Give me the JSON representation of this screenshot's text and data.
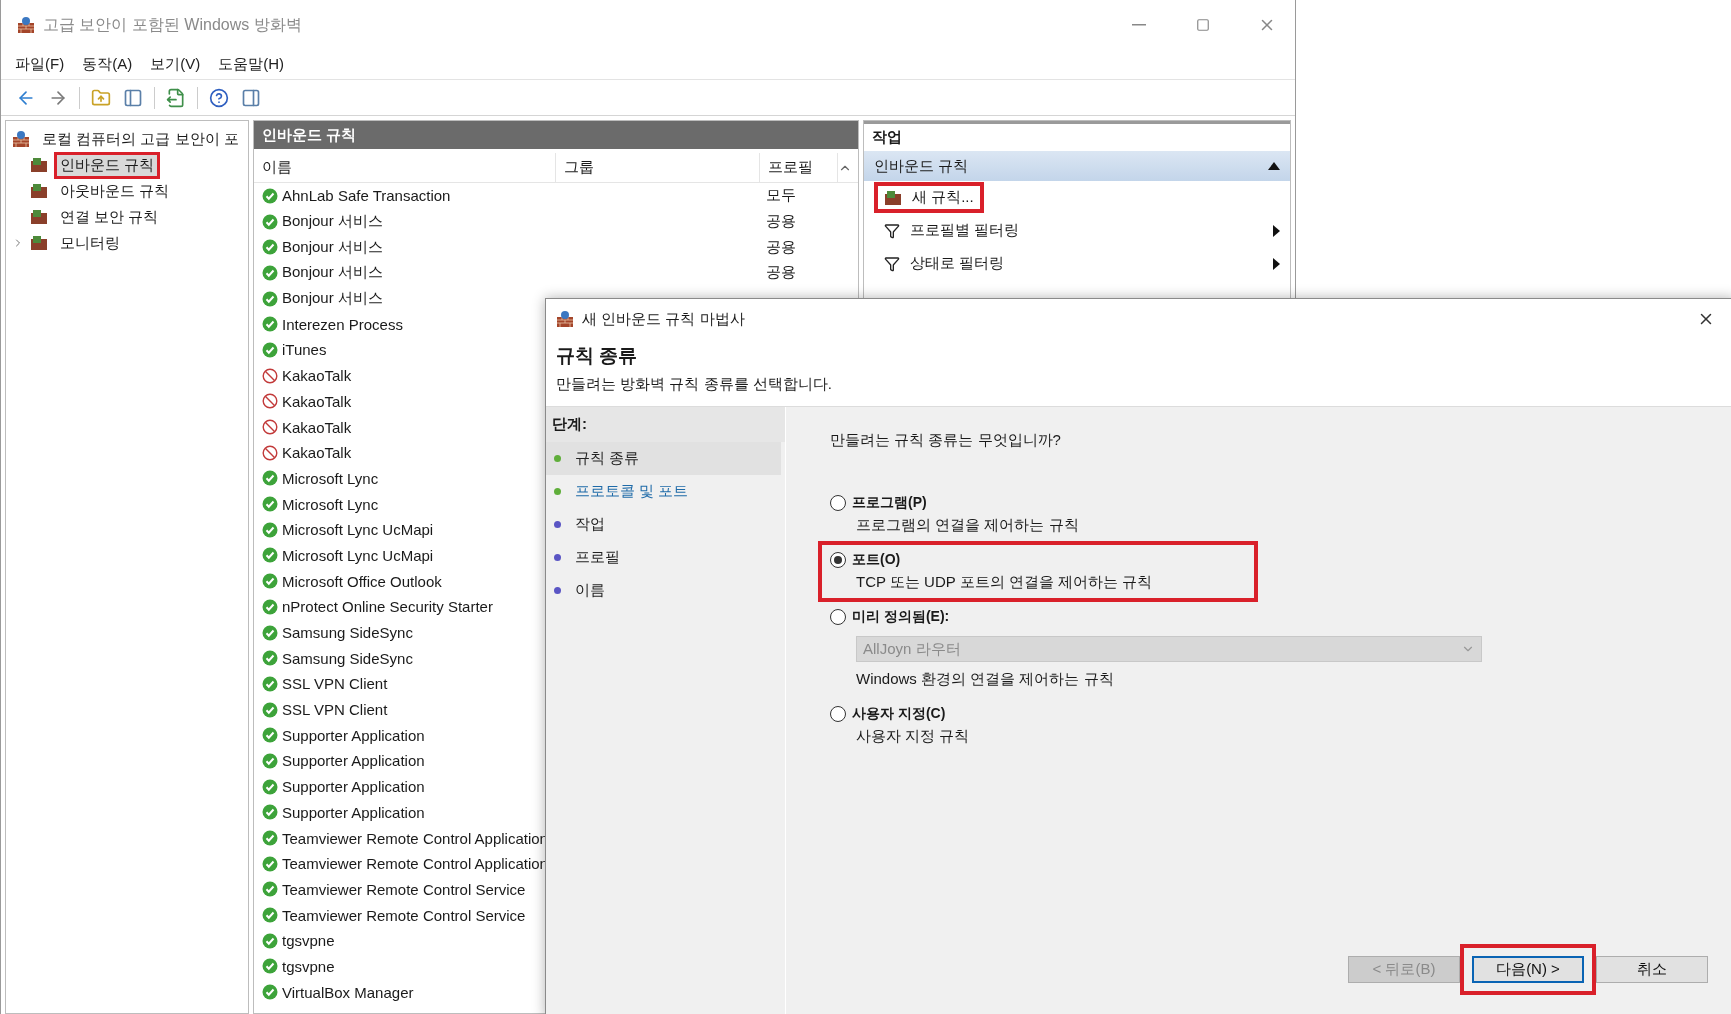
{
  "window": {
    "title": "고급 보안이 포함된 Windows 방화벽"
  },
  "menu": [
    "파일(F)",
    "동작(A)",
    "보기(V)",
    "도움말(H)"
  ],
  "tree": {
    "label": "로컬 컴퓨터의 고급 보안이 포",
    "children": [
      {
        "label": "인바운드 규칙",
        "selected": true,
        "highlighted": true
      },
      {
        "label": "아웃바운드 규칙",
        "selected": false,
        "highlighted": false
      },
      {
        "label": "연결 보안 규칙",
        "selected": false,
        "highlighted": false
      },
      {
        "label": "모니터링",
        "selected": false,
        "highlighted": false,
        "expanded": false
      }
    ]
  },
  "rules_pane": {
    "title": "인바운드 규칙",
    "columns": [
      "이름",
      "그룹",
      "프로필"
    ],
    "rows": [
      {
        "name": "AhnLab Safe Transaction",
        "kind": "allow",
        "profile": "모두"
      },
      {
        "name": "Bonjour 서비스",
        "kind": "allow",
        "profile": "공용"
      },
      {
        "name": "Bonjour 서비스",
        "kind": "allow",
        "profile": "공용"
      },
      {
        "name": "Bonjour 서비스",
        "kind": "allow",
        "profile": "공용"
      },
      {
        "name": "Bonjour 서비스",
        "kind": "allow"
      },
      {
        "name": "Interezen Process",
        "kind": "allow"
      },
      {
        "name": "iTunes",
        "kind": "allow"
      },
      {
        "name": "KakaoTalk",
        "kind": "block"
      },
      {
        "name": "KakaoTalk",
        "kind": "block"
      },
      {
        "name": "KakaoTalk",
        "kind": "block"
      },
      {
        "name": "KakaoTalk",
        "kind": "block"
      },
      {
        "name": "Microsoft Lync",
        "kind": "allow"
      },
      {
        "name": "Microsoft Lync",
        "kind": "allow"
      },
      {
        "name": "Microsoft Lync UcMapi",
        "kind": "allow"
      },
      {
        "name": "Microsoft Lync UcMapi",
        "kind": "allow"
      },
      {
        "name": "Microsoft Office Outlook",
        "kind": "allow"
      },
      {
        "name": "nProtect Online Security Starter",
        "kind": "allow"
      },
      {
        "name": "Samsung SideSync",
        "kind": "allow"
      },
      {
        "name": "Samsung SideSync",
        "kind": "allow"
      },
      {
        "name": "SSL VPN Client",
        "kind": "allow"
      },
      {
        "name": "SSL VPN Client",
        "kind": "allow"
      },
      {
        "name": "Supporter Application",
        "kind": "allow"
      },
      {
        "name": "Supporter Application",
        "kind": "allow"
      },
      {
        "name": "Supporter Application",
        "kind": "allow"
      },
      {
        "name": "Supporter Application",
        "kind": "allow"
      },
      {
        "name": "Teamviewer Remote Control Application",
        "kind": "allow"
      },
      {
        "name": "Teamviewer Remote Control Application",
        "kind": "allow"
      },
      {
        "name": "Teamviewer Remote Control Service",
        "kind": "allow"
      },
      {
        "name": "Teamviewer Remote Control Service",
        "kind": "allow"
      },
      {
        "name": "tgsvpne",
        "kind": "allow"
      },
      {
        "name": "tgsvpne",
        "kind": "allow"
      },
      {
        "name": "VirtualBox Manager",
        "kind": "allow"
      }
    ]
  },
  "actions_pane": {
    "title": "작업",
    "section": {
      "label": "인바운드 규칙",
      "expanded": true
    },
    "items": [
      {
        "label": "새 규칙...",
        "kind": "new",
        "submenu": false,
        "highlighted": true
      },
      {
        "label": "프로필별 필터링",
        "kind": "filter",
        "submenu": true,
        "highlighted": false
      },
      {
        "label": "상태로 필터링",
        "kind": "filter",
        "submenu": true,
        "highlighted": false
      }
    ]
  },
  "dialog": {
    "title": "새 인바운드 규칙 마법사",
    "heading": "규칙 종류",
    "subtitle": "만들려는 방화벽 규칙 종류를 선택합니다.",
    "steps_label": "단계:",
    "steps": [
      {
        "label": "규칙 종류",
        "selected": true,
        "done": true
      },
      {
        "label": "프로토콜 및 포트",
        "selected": false,
        "done": true
      },
      {
        "label": "작업",
        "selected": false,
        "done": false
      },
      {
        "label": "프로필",
        "selected": false,
        "done": false
      },
      {
        "label": "이름",
        "selected": false,
        "done": false
      }
    ],
    "question": "만들려는 규칙 종류는 무엇입니까?",
    "options": [
      {
        "label": "프로그램(P)",
        "description": "프로그램의 연결을 제어하는 규칙",
        "selected": false,
        "highlighted": false
      },
      {
        "label": "포트(O)",
        "description": "TCP 또는 UDP 포트의 연결을 제어하는 규칙",
        "selected": true,
        "highlighted": true
      },
      {
        "label": "미리 정의됨(E):",
        "dropdown": {
          "value": "AllJoyn 라우터",
          "disabled": true
        },
        "description": "Windows 환경의 연결을 제어하는 규칙",
        "selected": false,
        "highlighted": false
      },
      {
        "label": "사용자 지정(C)",
        "description": "사용자 지정 규칙",
        "selected": false,
        "highlighted": false
      }
    ],
    "buttons": [
      {
        "label": "< 뒤로(B)",
        "disabled": true,
        "default": false,
        "highlighted": false
      },
      {
        "label": "다음(N) >",
        "disabled": false,
        "default": true,
        "highlighted": true
      },
      {
        "label": "취소",
        "disabled": false,
        "default": false,
        "highlighted": false
      }
    ]
  }
}
